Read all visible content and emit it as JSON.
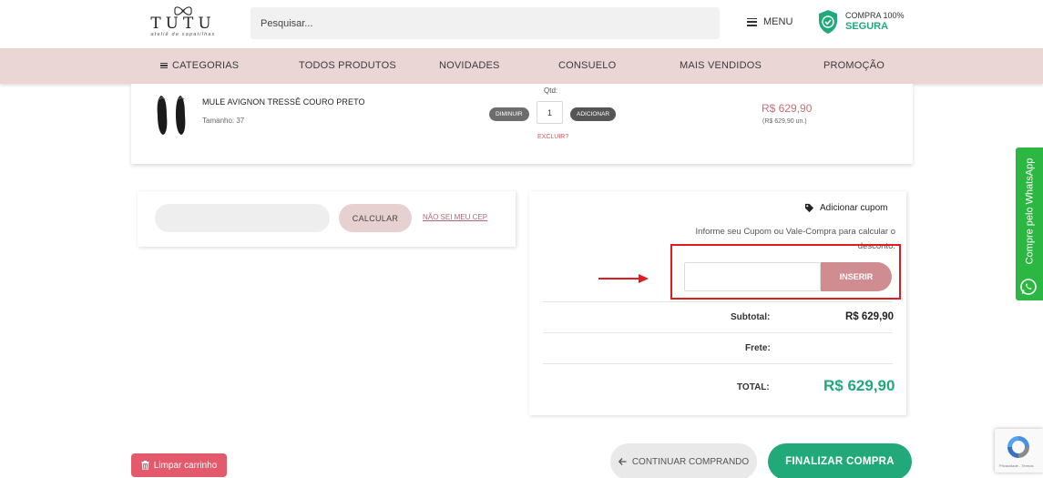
{
  "header": {
    "logo_word": "TUTU",
    "logo_sub": "ateliê de sapatilhas",
    "search_placeholder": "Pesquisar...",
    "menu_label": "MENU",
    "secure_line1": "COMPRA 100%",
    "secure_line2": "SEGURA"
  },
  "nav": {
    "items": [
      "CATEGORIAS",
      "TODOS PRODUTOS",
      "NOVIDADES",
      "CONSUELO",
      "MAIS VENDIDOS",
      "PROMOÇÃO"
    ]
  },
  "product": {
    "name": "MULE AVIGNON TRESSÊ COURO PRETO",
    "size": "Tamanho: 37",
    "qtd_label": "Qtd:",
    "decrease_label": "DIMINUIR",
    "quantity": "1",
    "add_label": "ADICIONAR",
    "remove_label": "EXCLUIR?",
    "price": "R$ 629,90",
    "unit_price": "(R$ 629,90 un.)"
  },
  "shipping": {
    "cep_placeholder": "",
    "calc_label": "CALCULAR",
    "unknown_cep_link": "NÃO SEI MEU CEP"
  },
  "summary": {
    "coupon_title": "Adicionar cupom",
    "coupon_desc": "Informe seu Cupom ou Vale-Compra para calcular o desconto.",
    "coupon_input_value": "",
    "insert_label": "INSERIR",
    "subtotal_label": "Subtotal:",
    "subtotal_value": "R$ 629,90",
    "frete_label": "Frete:",
    "frete_value": "",
    "total_label": "TOTAL:",
    "total_value": "R$ 629,90"
  },
  "whatsapp": {
    "label": "Compre pelo WhatsApp"
  },
  "actions": {
    "clear_cart": "Limpar carrinho",
    "continue_shopping": "CONTINUAR COMPRANDO",
    "checkout": "FINALIZAR COMPRA"
  },
  "recaptcha": {
    "text": "Privacidade - Termos"
  },
  "colors": {
    "nav_bg": "#ebd6d6",
    "accent_green": "#21a97a",
    "insert_button": "#cf8d91",
    "price_pink": "#c76d7a",
    "clear_button": "#e25a6b",
    "annotation_red": "#e01b22",
    "whatsapp_green": "#2bb741"
  }
}
